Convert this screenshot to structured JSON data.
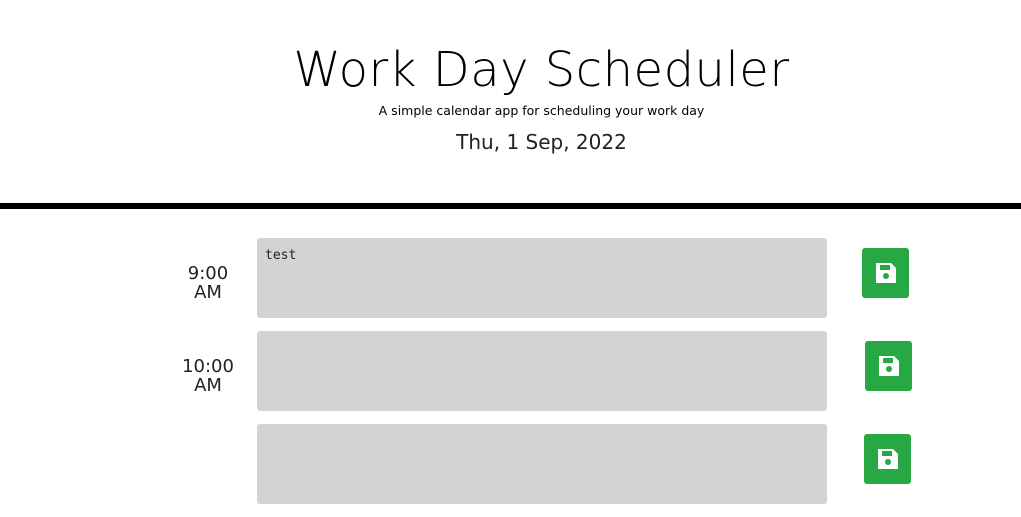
{
  "header": {
    "title": "Work Day Scheduler",
    "subtitle": "A simple calendar app for scheduling your work day",
    "current_day": "Thu, 1 Sep, 2022"
  },
  "rows": [
    {
      "hour_line1": "9:00",
      "hour_line2": "AM",
      "text": "test",
      "save_icon": "floppy-disk-icon"
    },
    {
      "hour_line1": "10:00",
      "hour_line2": "AM",
      "text": "",
      "save_icon": "floppy-disk-icon"
    },
    {
      "hour_line1": "",
      "hour_line2": "",
      "text": "",
      "save_icon": "floppy-disk-icon"
    }
  ],
  "colors": {
    "textarea_bg": "#d3d3d3",
    "save_button": "#28a745",
    "divider": "#000000"
  }
}
